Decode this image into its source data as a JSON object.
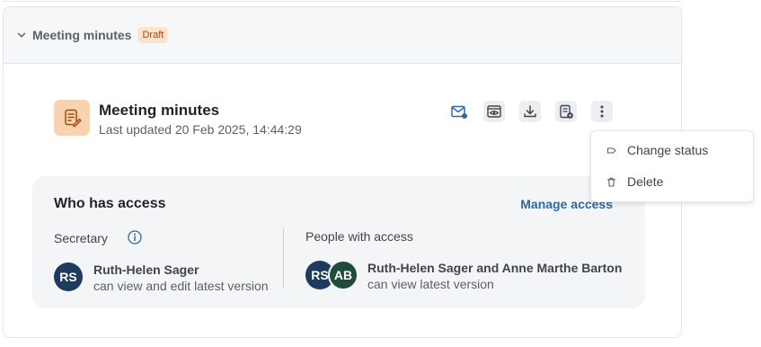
{
  "section": {
    "title": "Meeting minutes",
    "badge": "Draft"
  },
  "document": {
    "title": "Meeting minutes",
    "updated": "Last updated 20 Feb 2025, 14:44:29"
  },
  "actions": [
    "mail-icon",
    "preview-icon",
    "download-icon",
    "document-settings-icon",
    "more-options-icon"
  ],
  "access": {
    "title": "Who has access",
    "manage_label": "Manage access",
    "secretary": {
      "label": "Secretary",
      "initials": "RS",
      "name": "Ruth-Helen Sager",
      "permission": "can view and edit latest version"
    },
    "people": {
      "label": "People with access",
      "initials": [
        "RS",
        "AB"
      ],
      "names": "Ruth-Helen Sager and Anne Marthe Barton",
      "permission": "can view latest version"
    }
  },
  "menu": {
    "items": [
      {
        "label": "Change status",
        "icon": "tag-icon"
      },
      {
        "label": "Delete",
        "icon": "trash-icon"
      }
    ]
  },
  "colors": {
    "badge_bg": "#fde3cc",
    "badge_text": "#a14b11",
    "link": "#2c6aa5",
    "avatar_navy": "#1f3a5f",
    "avatar_green": "#1f4d3a",
    "doc_icon_bg": "#f9d3b0"
  }
}
